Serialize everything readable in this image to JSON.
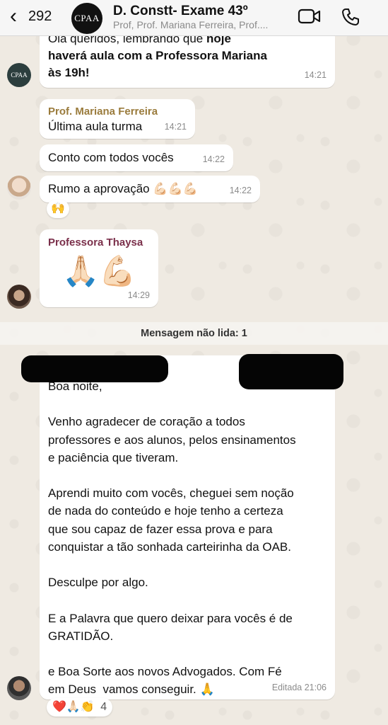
{
  "header": {
    "back_count": "292",
    "group_avatar_text": "CPAA",
    "title": "D. Constt- Exame 43º",
    "subtitle": "Prof, Prof. Mariana Ferreira, Prof...."
  },
  "messages": {
    "m1": {
      "line1": "Olá queridos, lembrando que ",
      "line1_bold": "hoje",
      "line2": "haverá aula com a Professora Mariana",
      "line3": "às 19h!",
      "time": "14:21"
    },
    "m2": {
      "sender": "Prof. Mariana Ferreira",
      "sender_color": "#9a7b3c",
      "text": "Última aula turma",
      "time": "14:21"
    },
    "m3": {
      "text": "Conto com todos vocês",
      "time": "14:22"
    },
    "m4": {
      "text": "Rumo a aprovação 💪🏻💪🏻💪🏻",
      "time": "14:22",
      "reaction": "🙌"
    },
    "m5": {
      "sender": "Professora Thaysa",
      "sender_color": "#7a2f4a",
      "text": "🙏🏻💪🏻",
      "time": "14:29"
    },
    "unread": "Mensagem não lida: 1",
    "m6": {
      "text": "Boa noite,\n\nVenho agradecer de coração a todos\nprofessores e aos alunos, pelos ensinamentos\ne paciência que tiveram.\n\nAprendi muito com vocês, cheguei sem noção\nde nada do conteúdo e hoje tenho a certeza\nque sou capaz de fazer essa prova e para\nconquistar a tão sonhada carteirinha da OAB.\n\nDesculpe por algo.\n\nE a Palavra que quero deixar para vocês é de\nGRATIDÃO.\n\ne Boa Sorte aos novos Advogados. Com Fé\nem Deus  vamos conseguir. 🙏",
      "time": "Editada 21:06",
      "reactions": "❤️🙏🏻👏",
      "reaction_count": "4"
    }
  }
}
